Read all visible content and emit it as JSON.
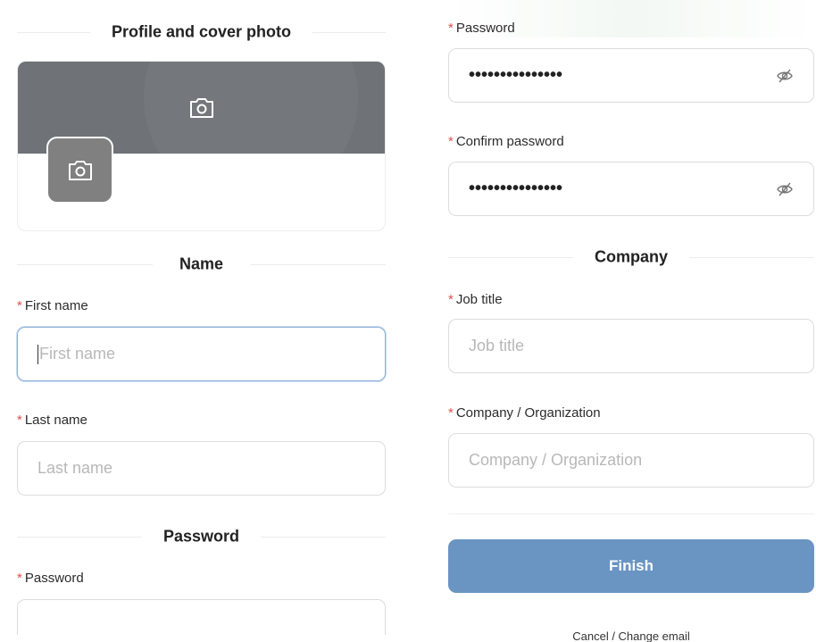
{
  "left": {
    "profile_section_title": "Profile and cover photo",
    "name_section_title": "Name",
    "first_name": {
      "label": "First name",
      "placeholder": "First name",
      "required_mark": "*"
    },
    "last_name": {
      "label": "Last name",
      "placeholder": "Last name",
      "required_mark": "*"
    },
    "password_section_title": "Password",
    "password": {
      "label": "Password",
      "required_mark": "*"
    }
  },
  "right": {
    "password": {
      "label": "Password",
      "value": "•••••••••••••••",
      "required_mark": "*"
    },
    "confirm_password": {
      "label": "Confirm password",
      "value": "•••••••••••••••",
      "required_mark": "*"
    },
    "company_section_title": "Company",
    "job_title": {
      "label": "Job title",
      "placeholder": "Job title",
      "required_mark": "*"
    },
    "company": {
      "label": "Company / Organization",
      "placeholder": "Company / Organization",
      "required_mark": "*"
    },
    "finish_label": "Finish",
    "cancel_label": "Cancel / Change email"
  },
  "icons": {
    "cover_camera": "camera-icon",
    "avatar_camera": "camera-icon",
    "password_toggle": "eye-off-icon"
  },
  "colors": {
    "accent_button": "#6a94c2",
    "required": "#e0504d",
    "cover_bg": "#6f7276",
    "avatar_bg": "#808080",
    "focus_border": "#8fb0d8"
  }
}
